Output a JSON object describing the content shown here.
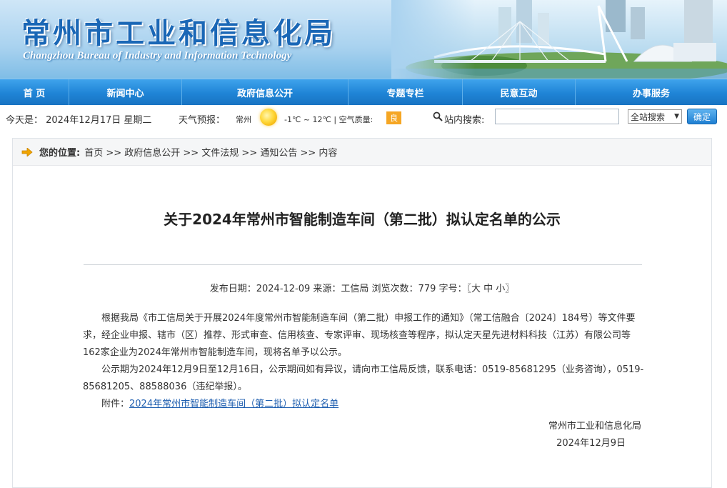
{
  "header": {
    "title": "常州市工业和信息化局",
    "subtitle": "Changzhou Bureau of Industry and Information Technology"
  },
  "nav": [
    {
      "label": "首 页",
      "width": 97
    },
    {
      "label": "新闻中心",
      "width": 158
    },
    {
      "label": "政府信息公开",
      "width": 233
    },
    {
      "label": "专题专栏",
      "width": 160
    },
    {
      "label": "民意互动",
      "width": 158
    },
    {
      "label": "办事服务",
      "width": 212
    }
  ],
  "infobar": {
    "date": "今天是： 2024年12月17日 星期二",
    "weather_label": "天气预报：",
    "city": "常州",
    "temperature": "-1℃ ~ 12℃ | 空气质量:",
    "air_quality": "良",
    "search_label": "站内搜索:",
    "search_value": "",
    "scope": "全站搜索",
    "submit": "确定"
  },
  "breadcrumb": {
    "lead": "您的位置:",
    "path": "首页 >> 政府信息公开 >> 文件法规 >> 通知公告 >> 内容"
  },
  "article": {
    "title": "关于2024年常州市智能制造车间（第二批）拟认定名单的公示",
    "meta": "发布日期：2024-12-09  来源：工信局  浏览次数：779  字号：〖大 中 小〗",
    "para1": "根据我局《市工信局关于开展2024年度常州市智能制造车间（第二批）申报工作的通知》（常工信融合〔2024〕184号）等文件要求，经企业申报、辖市（区）推荐、形式审查、信用核查、专家评审、现场核查等程序，拟认定天星先进材料科技（江苏）有限公司等162家企业为2024年常州市智能制造车间，现将名单予以公示。",
    "para2": "公示期为2024年12月9日至12月16日，公示期间如有异议，请向市工信局反馈，联系电话：0519-85681295（业务咨询），0519-85681205、88588036（违纪举报）。",
    "attachment_label": "附件：",
    "attachment_link": "2024年常州市智能制造车间（第二批）拟认定名单",
    "issuer": "常州市工业和信息化局",
    "issue_date": "2024年12月9日"
  },
  "colors": {
    "nav_blue": "#1f84d6",
    "link": "#1f5fb0",
    "badge": "#f5a623"
  }
}
